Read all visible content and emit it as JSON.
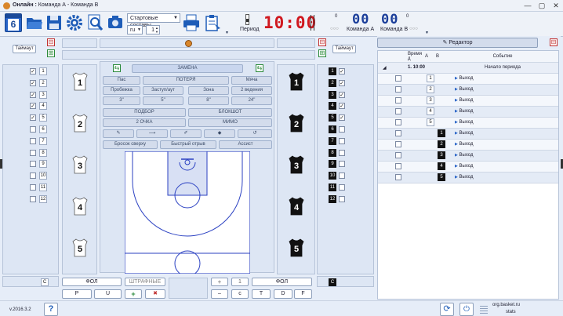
{
  "window": {
    "title_prefix": "Онлайн :",
    "team_a": "Команда А",
    "separator": "-",
    "team_b": "Команда В"
  },
  "toolbar": {
    "calendar_day": "6",
    "lineup_select": "Стартовые составы",
    "lang_select": "ru",
    "period_value": "1",
    "period_label": "Период",
    "clock": "10:00",
    "team_a_fouls": "0",
    "team_a_score": "00",
    "team_a_label": "Команда А",
    "team_b_fouls": "0",
    "team_b_score": "00",
    "team_b_label": "Команда В",
    "timeouts_dots": "○○○"
  },
  "left_panel": {
    "timeout_label": "Таймаут",
    "players": [
      "1",
      "2",
      "3",
      "4",
      "5",
      "6",
      "7",
      "8",
      "9",
      "10",
      "11",
      "12"
    ],
    "checked": [
      1,
      1,
      1,
      1,
      1,
      0,
      0,
      0,
      0,
      0,
      0,
      0
    ],
    "coach": "C"
  },
  "right_panel": {
    "timeout_label": "Таймаут",
    "players": [
      "1",
      "2",
      "3",
      "4",
      "5",
      "6",
      "7",
      "8",
      "9",
      "10",
      "11",
      "12"
    ],
    "checked": [
      1,
      1,
      1,
      1,
      1,
      0,
      0,
      0,
      0,
      0,
      0,
      0
    ],
    "coach": "C"
  },
  "court_a": [
    "1",
    "2",
    "3",
    "4",
    "5"
  ],
  "court_b": [
    "1",
    "2",
    "3",
    "4",
    "5"
  ],
  "actions": {
    "substitution": "ЗАМЕНА",
    "pass": "Пас",
    "loss": "ПОТЕРЯ",
    "ball": "Мяча",
    "travel": "Пробежка",
    "out": "Заступ/аут",
    "zone": "Зона",
    "double_dribble": "2 ведения",
    "s3": "3\"",
    "s5": "5\"",
    "s8": "8\"",
    "s24": "24\"",
    "rebound": "ПОДБОР",
    "block": "БЛОКШОТ",
    "two_points": "2 ОЧКА",
    "miss": "МИМО",
    "shot_top": "Бросок сверху",
    "fast_break": "Быстрый отрыв",
    "assist": "Ассист"
  },
  "bottom": {
    "foul_a": "ФОЛ",
    "free_throws": "ШТРАФНЫЕ",
    "foul_b": "ФОЛ",
    "btn_p": "P",
    "btn_u": "U",
    "btn_plus": "+",
    "btn_x": "✖",
    "btn_one": "1",
    "btn_minus": "–",
    "btn_c": "c",
    "btn_t": "T",
    "btn_d": "D",
    "btn_f": "F"
  },
  "events": {
    "editor_label": "Редактор",
    "columns": [
      "Время д",
      "A",
      "B",
      "Событие"
    ],
    "period_row": {
      "time": "1. 10:00",
      "event": "Начало периода"
    },
    "rows": [
      {
        "team": "A",
        "num": "1",
        "event": "Выход"
      },
      {
        "team": "A",
        "num": "2",
        "event": "Выход"
      },
      {
        "team": "A",
        "num": "3",
        "event": "Выход"
      },
      {
        "team": "A",
        "num": "4",
        "event": "Выход"
      },
      {
        "team": "A",
        "num": "5",
        "event": "Выход"
      },
      {
        "team": "B",
        "num": "1",
        "event": "Выход"
      },
      {
        "team": "B",
        "num": "2",
        "event": "Выход"
      },
      {
        "team": "B",
        "num": "3",
        "event": "Выход"
      },
      {
        "team": "B",
        "num": "4",
        "event": "Выход"
      },
      {
        "team": "B",
        "num": "5",
        "event": "Выход"
      }
    ]
  },
  "status": {
    "version": "v.2016.3.2",
    "help": "?",
    "site": "org.basket.ru",
    "stats": "stats"
  }
}
